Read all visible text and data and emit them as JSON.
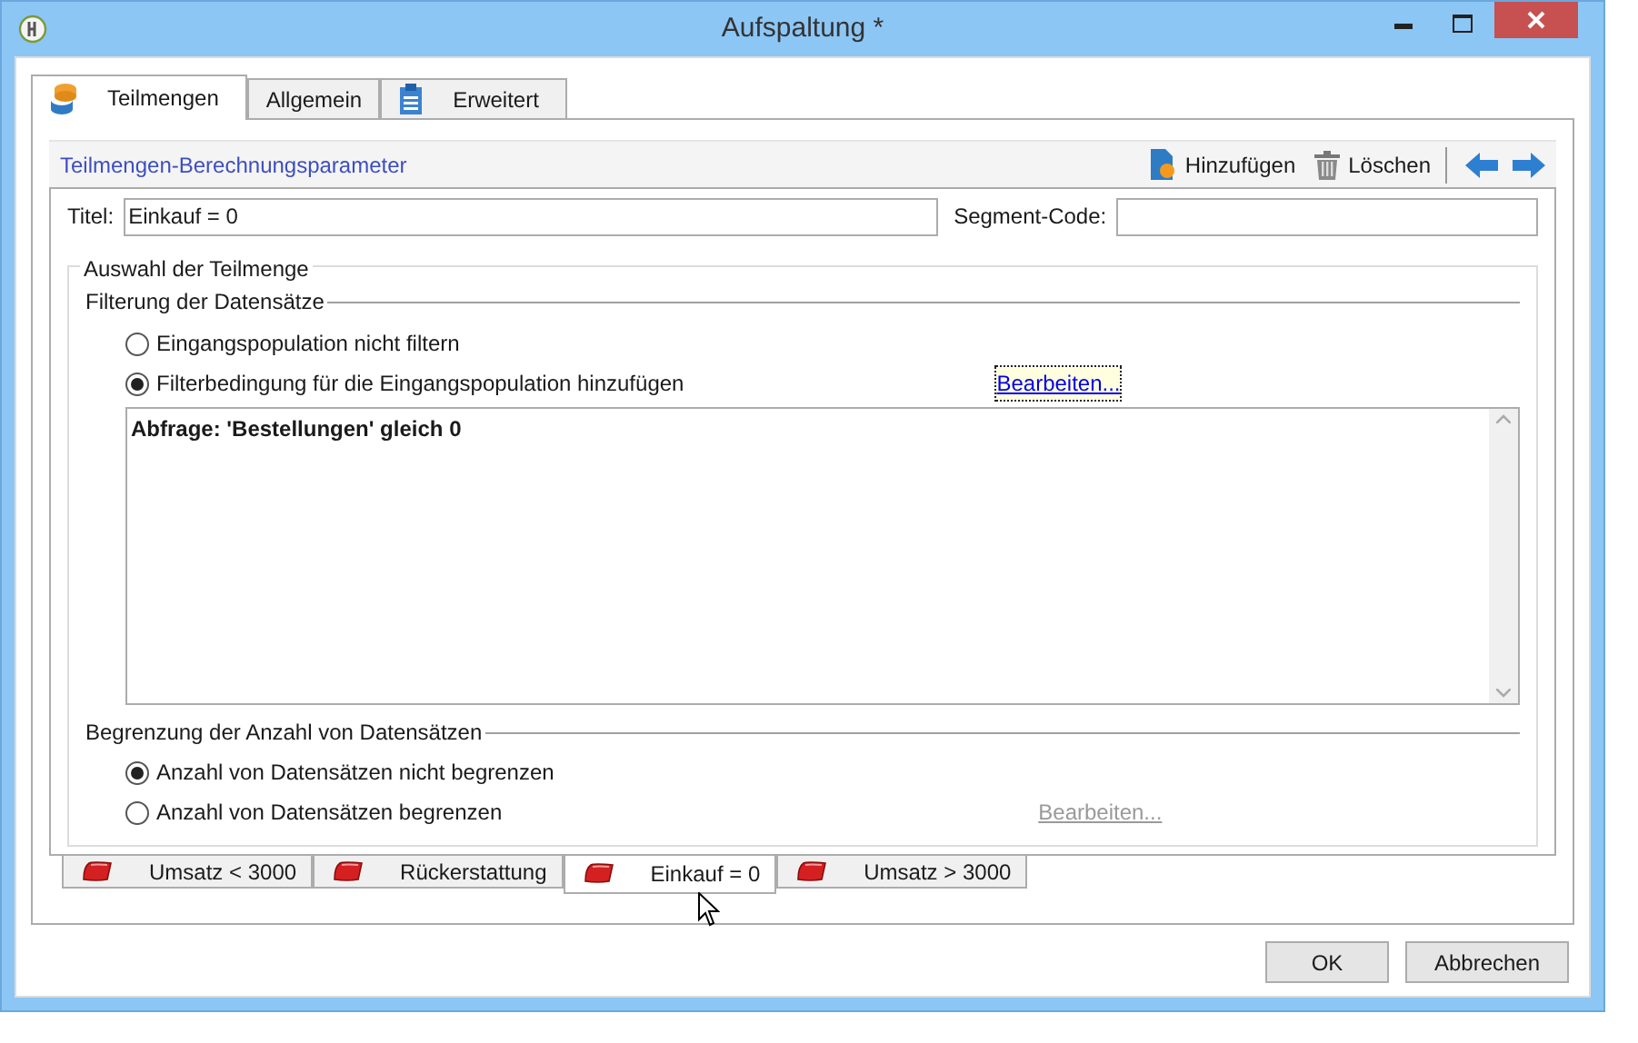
{
  "window": {
    "title": "Aufspaltung *"
  },
  "tabs": [
    {
      "label": "Teilmengen",
      "selected": true,
      "kind": "database"
    },
    {
      "label": "Allgemein",
      "selected": false,
      "kind": "plain"
    },
    {
      "label": "Erweitert",
      "selected": false,
      "kind": "clipboard"
    }
  ],
  "panel": {
    "title": "Teilmengen-Berechnungsparameter",
    "toolbar": [
      {
        "label": "Hinzufügen",
        "kind": "add"
      },
      {
        "label": "Löschen",
        "kind": "delete"
      }
    ]
  },
  "fields": {
    "title_label": "Titel:",
    "title_value": "Einkauf = 0",
    "code_label": "Segment-Code:"
  },
  "selection": {
    "legend": "Auswahl der Teilmenge",
    "filter": {
      "legend": "Filterung der Datensätze",
      "options": [
        {
          "label": "Eingangspopulation nicht filtern",
          "selected": false
        },
        {
          "label": "Filterbedingung für die Eingangspopulation hinzufügen",
          "selected": true
        }
      ],
      "edit_link": {
        "label": "Bearbeiten...",
        "disabled": false
      },
      "query": "Abfrage: 'Bestellungen' gleich 0"
    },
    "limit": {
      "legend": "Begrenzung der Anzahl von Datensätzen",
      "options": [
        {
          "label": "Anzahl von Datensätzen nicht begrenzen",
          "selected": true
        },
        {
          "label": "Anzahl von Datensätzen begrenzen",
          "selected": false
        }
      ],
      "edit_link": {
        "label": "Bearbeiten...",
        "disabled": true
      }
    }
  },
  "subsets": [
    {
      "label": "Umsatz < 3000",
      "selected": false
    },
    {
      "label": "Rückerstattung",
      "selected": false
    },
    {
      "label": "Einkauf = 0",
      "selected": true
    },
    {
      "label": "Umsatz > 3000",
      "selected": false
    }
  ],
  "buttons": [
    "OK",
    "Abbrechen"
  ]
}
